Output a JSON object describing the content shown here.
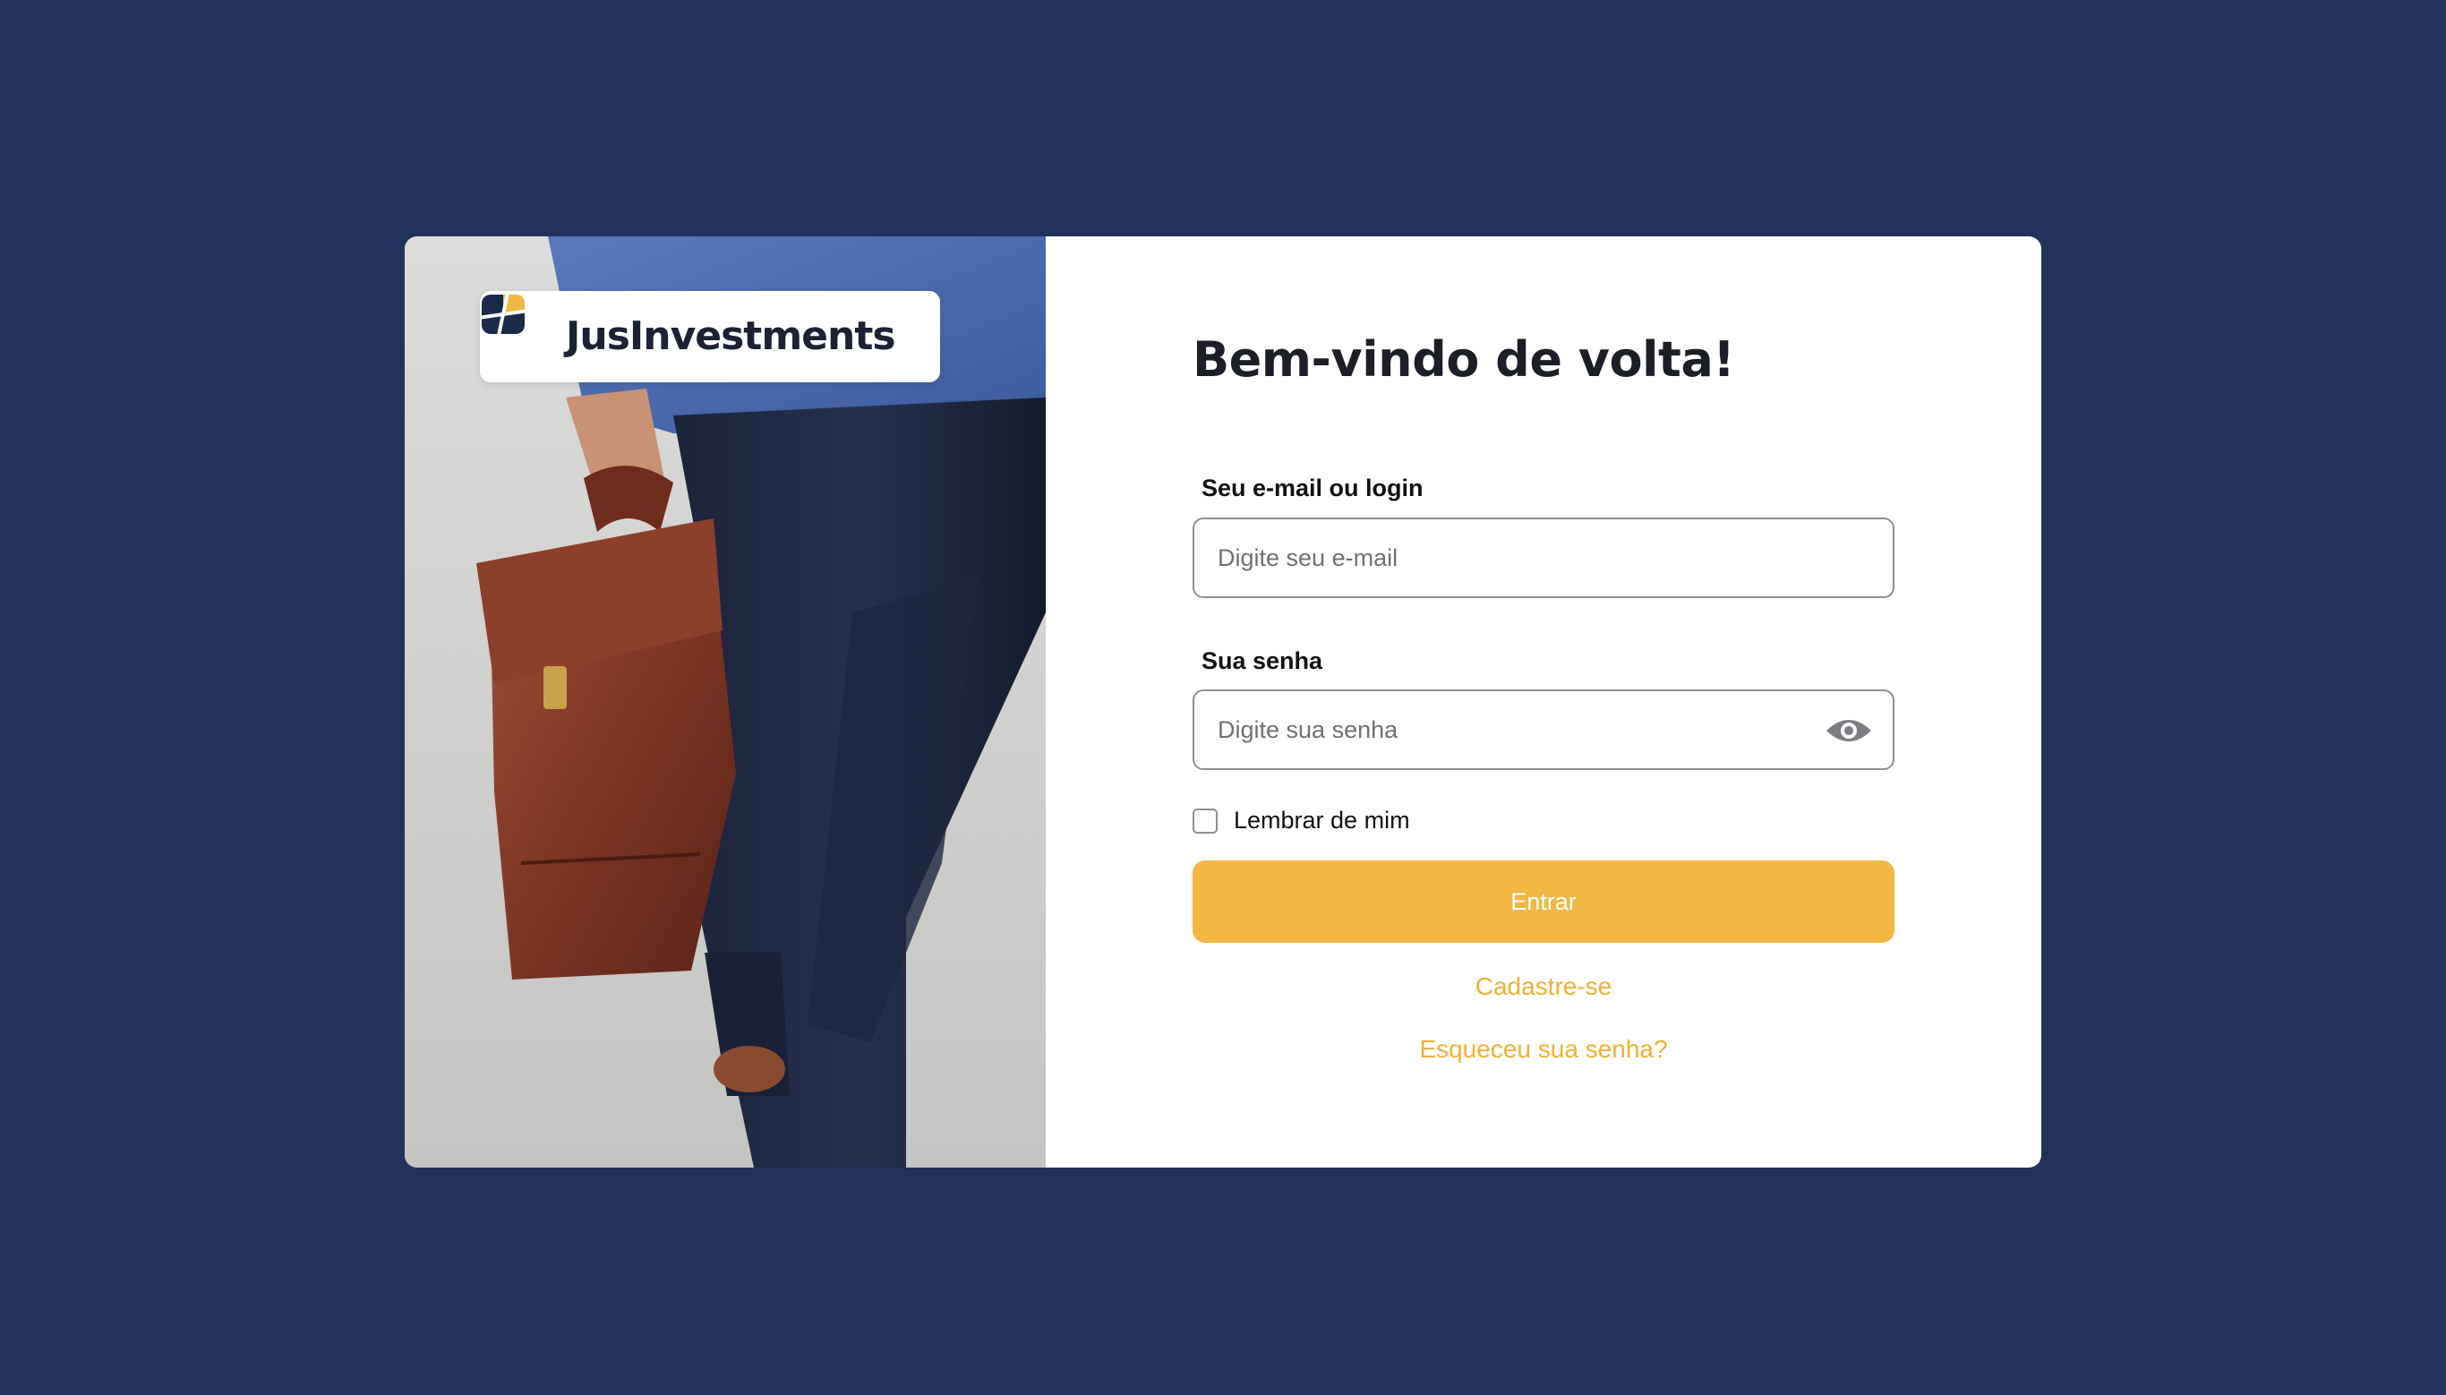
{
  "brand": {
    "name": "JusInvestments",
    "logo_icon": "jusinvestments-logo-icon"
  },
  "login": {
    "heading": "Bem-vindo de volta!",
    "email_label": "Seu e-mail ou login",
    "email_placeholder": "Digite seu e-mail",
    "email_value": "",
    "password_label": "Sua senha",
    "password_placeholder": "Digite sua senha",
    "password_value": "",
    "password_toggle_icon": "eye-icon",
    "remember_label": "Lembrar de mim",
    "remember_checked": false,
    "submit_label": "Entrar",
    "signup_link": "Cadastre-se",
    "forgot_link": "Esqueceu sua senha?"
  },
  "colors": {
    "background": "#22325a",
    "accent": "#f2b843",
    "link": "#f2b032",
    "card": "#ffffff"
  }
}
